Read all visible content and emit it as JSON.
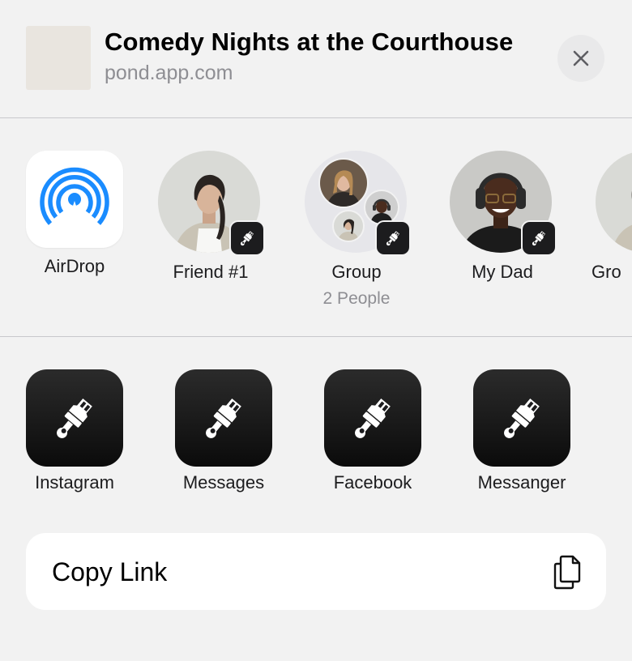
{
  "header": {
    "title": "Comedy Nights at the Courthouse",
    "subtitle": "pond.app.com",
    "close_icon": "close-icon"
  },
  "contacts": [
    {
      "label": "AirDrop",
      "icon": "airdrop-icon"
    },
    {
      "label": "Friend #1",
      "badge_icon": "brush-icon"
    },
    {
      "label": "Group",
      "sublabel": "2 People",
      "badge_icon": "brush-icon"
    },
    {
      "label": "My Dad",
      "badge_icon": "brush-icon"
    },
    {
      "label": "Gro"
    }
  ],
  "apps": [
    {
      "label": "Instagram",
      "icon": "brush-icon"
    },
    {
      "label": "Messages",
      "icon": "brush-icon"
    },
    {
      "label": "Facebook",
      "icon": "brush-icon"
    },
    {
      "label": "Messanger",
      "icon": "brush-icon"
    }
  ],
  "copy_link": {
    "label": "Copy Link",
    "icon": "copy-icon"
  },
  "colors": {
    "sheet_bg": "#f2f2f2",
    "secondary_text": "#8e8e93",
    "airdrop_blue": "#1a8cff",
    "app_icon_bg": "#111111"
  }
}
